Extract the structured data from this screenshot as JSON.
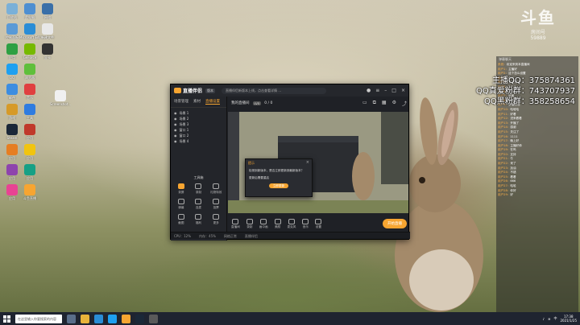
{
  "desktop": {
    "icons": [
      {
        "name": "recycle-bin-icon",
        "label": "回收站",
        "color": "#7ab0d8"
      },
      {
        "name": "computer-icon",
        "label": "此电脑",
        "color": "#4e8fd1"
      },
      {
        "name": "network-icon",
        "label": "网络",
        "color": "#3a6fa8"
      },
      {
        "name": "control-panel-icon",
        "label": "控制面板",
        "color": "#5a9ad6"
      },
      {
        "name": "edge-icon",
        "label": "Microsoft Edge",
        "color": "#2a8dd6"
      },
      {
        "name": "file-icon",
        "label": "新建文件",
        "color": "#e8e8e8"
      },
      {
        "name": "app-icon-green",
        "label": "应用",
        "color": "#2ea043"
      },
      {
        "name": "nvidia-icon",
        "label": "GeForce",
        "color": "#76b900"
      },
      {
        "name": "gpu-icon",
        "label": "显卡",
        "color": "#333333"
      },
      {
        "name": "qq-icon",
        "label": "QQ",
        "color": "#1ea0f0"
      },
      {
        "name": "browser-icon",
        "label": "浏览器",
        "color": "#5fbf3b"
      },
      {
        "name": "mail-icon",
        "label": "邮件",
        "color": "#3c8de0"
      },
      {
        "name": "music-icon",
        "label": "音乐",
        "color": "#e04040"
      },
      {
        "name": "game-icon",
        "label": "游戏",
        "color": "#d69a28"
      },
      {
        "name": "app-icon-blue",
        "label": "工具",
        "color": "#2f7ce0"
      },
      {
        "name": "steam-icon",
        "label": "Steam",
        "color": "#1b2838"
      },
      {
        "name": "app-icon-red",
        "label": "应用",
        "color": "#c0392b"
      },
      {
        "name": "app-icon-orange",
        "label": "应用",
        "color": "#e67e22"
      },
      {
        "name": "app-icon-yellow",
        "label": "应用",
        "color": "#f1c40f"
      },
      {
        "name": "app-icon-purple",
        "label": "应用",
        "color": "#8e44ad"
      },
      {
        "name": "app-icon-teal",
        "label": "应用",
        "color": "#16a085"
      },
      {
        "name": "app-icon-pink",
        "label": "应用",
        "color": "#e84393"
      },
      {
        "name": "douyu-icon",
        "label": "斗鱼直播",
        "color": "#f7a531"
      }
    ],
    "doc_icon_label": "Screenshot..."
  },
  "watermark": {
    "brand": "斗鱼",
    "sub": "房间号",
    "room": "59889"
  },
  "overlay": {
    "line1": "主播QQ：375874361",
    "line2": "QQ真爱粉群：743707937",
    "line3": "QQ黑粉群：358258654"
  },
  "chat": {
    "header": "弹幕聊天",
    "lines": [
      {
        "user": "系统：",
        "text": "欢迎来到本直播间"
      },
      {
        "user": "用户1：",
        "text": "主播好"
      },
      {
        "user": "用户2：",
        "text": "这个怎么设置"
      },
      {
        "user": "用户3：",
        "text": "666"
      },
      {
        "user": "用户4：",
        "text": "来了来了"
      },
      {
        "user": "用户5：",
        "text": "？？？"
      },
      {
        "user": "用户6：",
        "text": "打卡"
      },
      {
        "user": "用户7：",
        "text": "厉害"
      },
      {
        "user": "用户8：",
        "text": "学到了"
      },
      {
        "user": "用户9：",
        "text": "主播加油"
      },
      {
        "user": "用户10：",
        "text": "哈哈哈"
      },
      {
        "user": "用户11：",
        "text": "好看"
      },
      {
        "user": "用户12：",
        "text": "进来看看"
      },
      {
        "user": "用户13：",
        "text": "开播了"
      },
      {
        "user": "用户14：",
        "text": "感谢"
      },
      {
        "user": "用户15：",
        "text": "关注了"
      },
      {
        "user": "用户16：",
        "text": "1111"
      },
      {
        "user": "用户17：",
        "text": "晚上好"
      },
      {
        "user": "用户18：",
        "text": "主播好帅"
      },
      {
        "user": "用户19：",
        "text": "在吗"
      },
      {
        "user": "用户20：",
        "text": "支持"
      },
      {
        "user": "用户21：",
        "text": "牛"
      },
      {
        "user": "用户22：",
        "text": "来了"
      },
      {
        "user": "用户23：",
        "text": "加油"
      },
      {
        "user": "用户24：",
        "text": "不错"
      },
      {
        "user": "用户25：",
        "text": "看看"
      },
      {
        "user": "用户26：",
        "text": "666"
      },
      {
        "user": "用户27：",
        "text": "哈哈"
      },
      {
        "user": "用户28：",
        "text": "你好"
      },
      {
        "user": "用户29：",
        "text": "好"
      }
    ]
  },
  "app": {
    "brand": "直播伴侣",
    "version_tag": "版本",
    "ticker": "直播伴侣新版本上线，点击查看详情 …",
    "tabs": [
      "场景管理",
      "素材",
      "直播设置"
    ],
    "active_tab": 2,
    "scenes": [
      "场景 1",
      "场景 2",
      "场景 3",
      "窗口 1",
      "窗口 2",
      "场景 4"
    ],
    "tools_title": "工具箱",
    "tools": [
      "录屏",
      "录制",
      "礼物特效",
      "弹幕",
      "连麦",
      "投票",
      "截图",
      "福利",
      "更多"
    ],
    "room_title": "我的直播间",
    "room_level": "LV5",
    "room_stats": "0 / 0",
    "bottom_buttons": [
      "直播间",
      "录制",
      "画中画",
      "美颜",
      "麦克风",
      "音乐",
      "设置"
    ],
    "live_button": "开始直播",
    "status": [
      "CPU：12%",
      "内存：45%",
      "网络正常",
      "直播伴侣"
    ],
    "modal": {
      "title": "提示",
      "body": "检测到新版本，是否立即更新到最新版本？",
      "sub": "更新后需要重启",
      "button": "立即更新"
    }
  },
  "taskbar": {
    "search_placeholder": "在这里输入你要搜索的内容",
    "apps": [
      "task-view-icon",
      "file-explorer-icon",
      "edge-icon",
      "qq-icon",
      "douyu-icon",
      "steam-icon",
      "obs-icon"
    ],
    "tray_lang": "中",
    "time": "17:38",
    "date": "2021/1/25"
  }
}
